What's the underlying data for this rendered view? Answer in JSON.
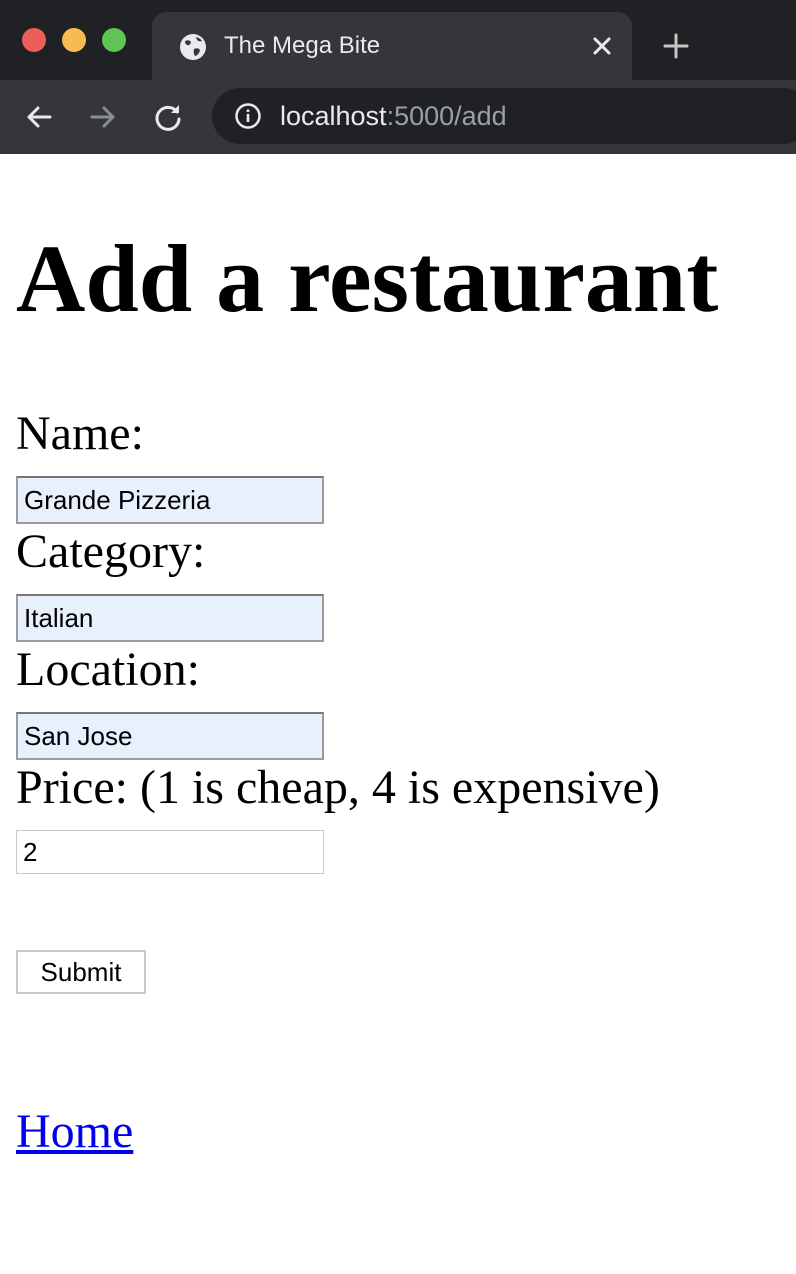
{
  "browser": {
    "tab_title": "The Mega Bite",
    "url_host": "localhost",
    "url_rest": ":5000/add",
    "icons": {
      "favicon": "globe-icon",
      "tab_close": "close-icon",
      "new_tab": "plus-icon",
      "back": "arrow-left-icon",
      "forward": "arrow-right-icon",
      "reload": "reload-icon",
      "site_info": "info-icon"
    },
    "colors": {
      "red": "#ee5e58",
      "yellow": "#f5bd4f",
      "green": "#5fc454"
    }
  },
  "page": {
    "heading": "Add a restaurant",
    "form": {
      "name_label": "Name:",
      "name_value": "Grande Pizzeria",
      "category_label": "Category:",
      "category_value": "Italian",
      "location_label": "Location:",
      "location_value": "San Jose",
      "price_label": "Price: (1 is cheap, 4 is expensive)",
      "price_value": "2",
      "submit_label": "Submit"
    },
    "home_link": "Home",
    "colors": {
      "link": "#0000ee",
      "autofill": "#e8f0fe"
    }
  }
}
